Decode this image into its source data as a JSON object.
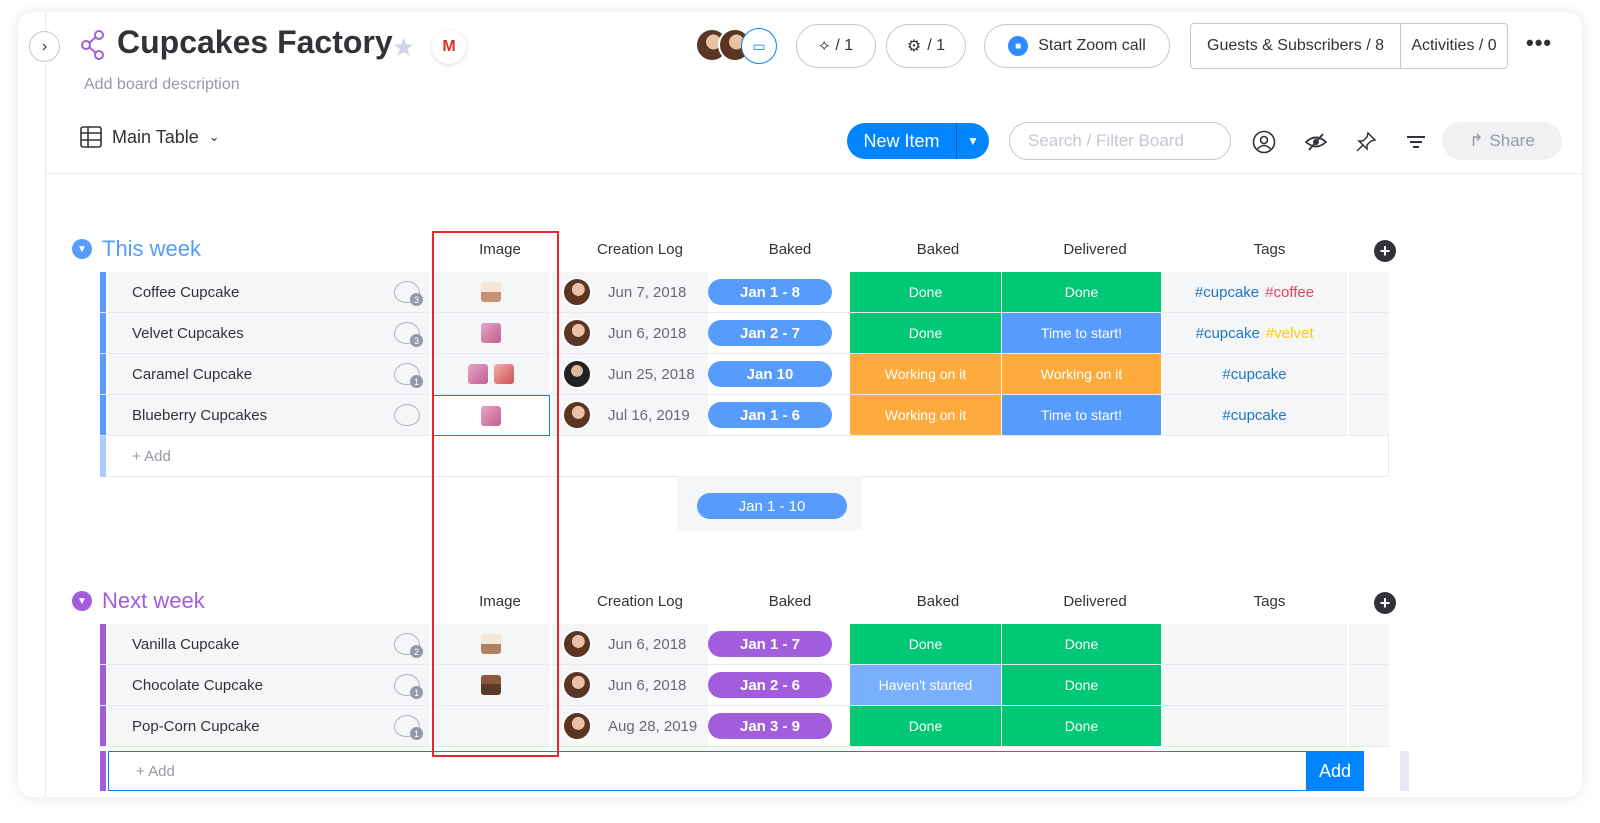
{
  "header": {
    "title": "Cupcakes Factory",
    "description": "Add board description",
    "integrations_count": "/ 1",
    "automations_count": "/ 1",
    "zoom_label": "Start Zoom call",
    "guests_label": "Guests & Subscribers / 8",
    "activities_label": "Activities / 0"
  },
  "toolbar": {
    "view_label": "Main Table",
    "new_item_label": "New Item",
    "search_placeholder": "Search / Filter Board",
    "share_label": "Share"
  },
  "columns": {
    "image": "Image",
    "creation_log": "Creation Log",
    "baked_timeline": "Baked",
    "baked_status": "Baked",
    "delivered": "Delivered",
    "tags": "Tags"
  },
  "groups": [
    {
      "title": "This week",
      "color": "#579bfc",
      "rows": [
        {
          "name": "Coffee Cupcake",
          "comments": "3",
          "date": "Jun 7, 2018",
          "timeline": "Jan 1 - 8",
          "baked": "Done",
          "delivered": "Done",
          "tags": [
            "#cupcake",
            "#coffee"
          ]
        },
        {
          "name": "Velvet Cupcakes",
          "comments": "3",
          "date": "Jun 6, 2018",
          "timeline": "Jan 2 - 7",
          "baked": "Done",
          "delivered": "Time to start!",
          "tags": [
            "#cupcake",
            "#velvet"
          ]
        },
        {
          "name": "Caramel Cupcake",
          "comments": "1",
          "date": "Jun 25, 2018",
          "timeline": "Jan 10",
          "baked": "Working on it",
          "delivered": "Working on it",
          "tags": [
            "#cupcake"
          ]
        },
        {
          "name": "Blueberry Cupcakes",
          "comments": "",
          "date": "Jul 16, 2019",
          "timeline": "Jan 1 - 6",
          "baked": "Working on it",
          "delivered": "Time to start!",
          "tags": [
            "#cupcake"
          ]
        }
      ],
      "add_label": "+ Add",
      "summary_timeline": "Jan 1 - 10"
    },
    {
      "title": "Next week",
      "color": "#a25ddc",
      "rows": [
        {
          "name": "Vanilla Cupcake",
          "comments": "2",
          "date": "Jun 6, 2018",
          "timeline": "Jan 1 - 7",
          "baked": "Done",
          "delivered": "Done",
          "tags": []
        },
        {
          "name": "Chocolate Cupcake",
          "comments": "1",
          "date": "Jun 6, 2018",
          "timeline": "Jan 2 - 6",
          "baked": "Haven't started",
          "delivered": "Done",
          "tags": []
        },
        {
          "name": "Pop-Corn Cupcake",
          "comments": "1",
          "date": "Aug 28, 2019",
          "timeline": "Jan 3 - 9",
          "baked": "Done",
          "delivered": "Done",
          "tags": []
        }
      ],
      "add_label": "+ Add",
      "add_button": "Add"
    }
  ],
  "colors": {
    "done": "#00c875",
    "working": "#fdab3d",
    "time_to_start": "#579bfc",
    "havent_started": "#79affd",
    "highlight_box": "#e8262b"
  }
}
